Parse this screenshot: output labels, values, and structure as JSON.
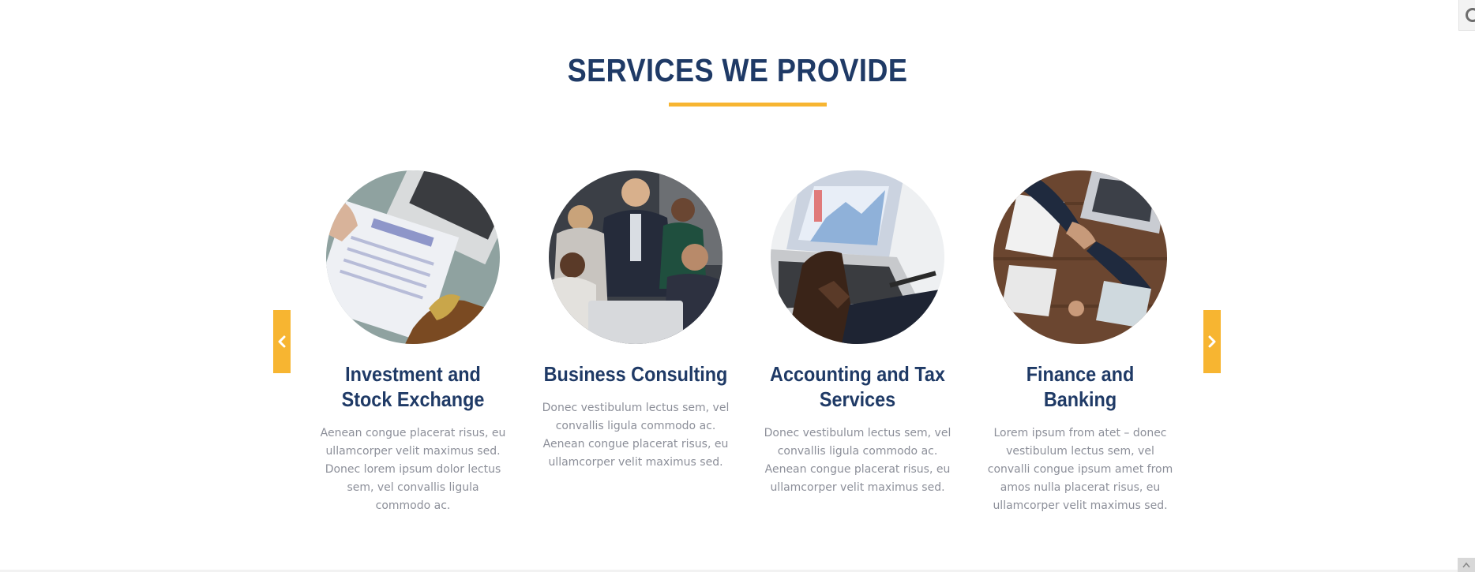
{
  "section": {
    "title": "SERVICES WE PROVIDE"
  },
  "colors": {
    "heading": "#1f3a66",
    "accent": "#f7b531",
    "body_text": "#8c8f99"
  },
  "carousel": {
    "prev_icon": "chevron-left-icon",
    "next_icon": "chevron-right-icon"
  },
  "services": [
    {
      "name": "Investment and Stock Exchange",
      "description": "Aenean congue placerat risus, eu ullamcorper velit maximus sed. Donec lorem ipsum dolor lectus sem, vel convallis ligula commodo ac.",
      "image": "invoice-and-laptop-photo"
    },
    {
      "name": "Business Consulting",
      "description": "Donec vestibulum lectus sem, vel convallis ligula commodo ac. Aenean congue placerat risus, eu ullamcorper velit maximus sed.",
      "image": "team-meeting-photo"
    },
    {
      "name": "Accounting and Tax Services",
      "description": "Donec vestibulum lectus sem, vel convallis ligula commodo ac. Aenean congue placerat risus, eu ullamcorper velit maximus sed.",
      "image": "laptop-chart-typing-photo"
    },
    {
      "name": "Finance and Banking",
      "description": "Lorem ipsum from atet – donec vestibulum lectus sem, vel convalli congue ipsum amet from amos nulla placerat risus, eu ullamcorper velit maximus sed.",
      "image": "handshake-desk-photo"
    }
  ]
}
